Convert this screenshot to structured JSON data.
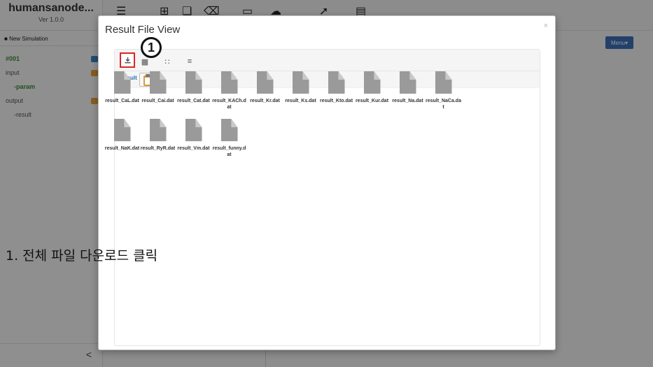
{
  "app": {
    "title": "humansanode...",
    "version": "Ver 1.0.0",
    "new_simulation": "New Simulation",
    "tree": {
      "sim_id": "#001",
      "input": "input",
      "param": "-param",
      "output": "output",
      "result": "-result"
    },
    "menu_label": "Menu",
    "collapse_glyph": "<"
  },
  "modal": {
    "title": "Result File View",
    "close": "×",
    "toolbar_icons": [
      "download-icon",
      "folder-icon",
      "grid-icon",
      "list-icon"
    ],
    "annotation_badge": "1",
    "path_label": "result",
    "files": [
      "result_CaL.dat",
      "result_Cai.dat",
      "result_Cat.dat",
      "result_KACh.dat",
      "result_Kr.dat",
      "result_Ks.dat",
      "result_Kto.dat",
      "result_Kur.dat",
      "result_Na.dat",
      "result_NaCa.dat",
      "result_NaK.dat",
      "result_RyR.dat",
      "result_Vm.dat",
      "result_funny.dat"
    ]
  },
  "caption": "1. 전체 파일 다운로드 클릭",
  "colors": {
    "highlight": "#e02424",
    "link": "#2a6fb0",
    "menu_button": "#3b6fb6",
    "file_icon": "#9a9a9a"
  }
}
